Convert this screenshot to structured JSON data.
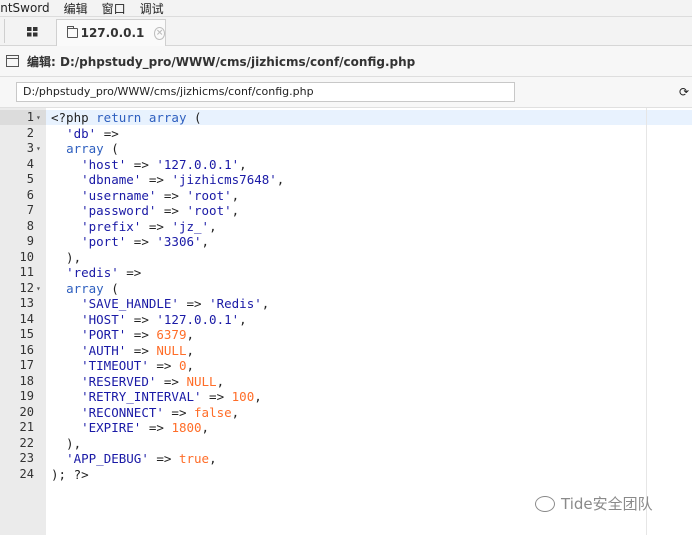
{
  "menu": {
    "items": [
      "AntSword",
      "编辑",
      "窗口",
      "调试"
    ]
  },
  "tabs": {
    "main_label": "127.0.0.1",
    "close_label": "×"
  },
  "panel": {
    "title": "编辑: D:/phpstudy_pro/WWW/cms/jizhicms/conf/config.php"
  },
  "pathbar": {
    "value": "D:/phpstudy_pro/WWW/cms/jizhicms/conf/config.php"
  },
  "editor": {
    "lines": [
      {
        "n": "1",
        "fold": "▾",
        "code": "<?php return array ("
      },
      {
        "n": "2",
        "fold": "",
        "code": "  'db' =>"
      },
      {
        "n": "3",
        "fold": "▾",
        "code": "  array ("
      },
      {
        "n": "4",
        "fold": "",
        "code": "    'host' => '127.0.0.1',"
      },
      {
        "n": "5",
        "fold": "",
        "code": "    'dbname' => 'jizhicms7648',"
      },
      {
        "n": "6",
        "fold": "",
        "code": "    'username' => 'root',"
      },
      {
        "n": "7",
        "fold": "",
        "code": "    'password' => 'root',"
      },
      {
        "n": "8",
        "fold": "",
        "code": "    'prefix' => 'jz_',"
      },
      {
        "n": "9",
        "fold": "",
        "code": "    'port' => '3306',"
      },
      {
        "n": "10",
        "fold": "",
        "code": "  ),"
      },
      {
        "n": "11",
        "fold": "",
        "code": "  'redis' =>"
      },
      {
        "n": "12",
        "fold": "▾",
        "code": "  array ("
      },
      {
        "n": "13",
        "fold": "",
        "code": "    'SAVE_HANDLE' => 'Redis',"
      },
      {
        "n": "14",
        "fold": "",
        "code": "    'HOST' => '127.0.0.1',"
      },
      {
        "n": "15",
        "fold": "",
        "code": "    'PORT' => 6379,"
      },
      {
        "n": "16",
        "fold": "",
        "code": "    'AUTH' => NULL,"
      },
      {
        "n": "17",
        "fold": "",
        "code": "    'TIMEOUT' => 0,"
      },
      {
        "n": "18",
        "fold": "",
        "code": "    'RESERVED' => NULL,"
      },
      {
        "n": "19",
        "fold": "",
        "code": "    'RETRY_INTERVAL' => 100,"
      },
      {
        "n": "20",
        "fold": "",
        "code": "    'RECONNECT' => false,"
      },
      {
        "n": "21",
        "fold": "",
        "code": "    'EXPIRE' => 1800,"
      },
      {
        "n": "22",
        "fold": "",
        "code": "  ),"
      },
      {
        "n": "23",
        "fold": "",
        "code": "  'APP_DEBUG' => true,"
      },
      {
        "n": "24",
        "fold": "",
        "code": "); ?>"
      }
    ]
  },
  "watermark": {
    "text": "Tide安全团队"
  },
  "icons": {
    "grid": "grid-icon",
    "folder": "folder-icon",
    "close": "close-icon",
    "panel": "panel-icon",
    "refresh": "refresh-icon",
    "wechat": "wechat-icon"
  },
  "colors": {
    "keyword": "#2e5fbf",
    "string": "#1a1aa6",
    "number": "#ff6d28",
    "active_line": "#e8f2fe"
  }
}
